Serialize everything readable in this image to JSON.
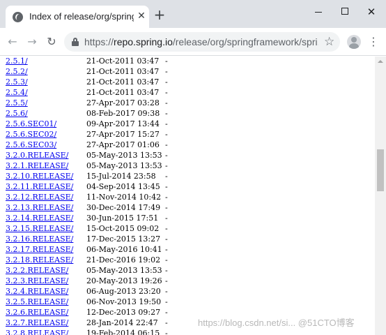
{
  "browser": {
    "tab_title": "Index of release/org/springframework",
    "url_scheme": "https://",
    "url_host": "repo.spring.io",
    "url_path": "/release/org/springframework/spri..."
  },
  "listing": {
    "rows": [
      {
        "name": "2.5.1/",
        "date": "21-Oct-2011 03:47",
        "size": "-"
      },
      {
        "name": "2.5.2/",
        "date": "21-Oct-2011 03:47",
        "size": "-"
      },
      {
        "name": "2.5.3/",
        "date": "21-Oct-2011 03:47",
        "size": "-"
      },
      {
        "name": "2.5.4/",
        "date": "21-Oct-2011 03:47",
        "size": "-"
      },
      {
        "name": "2.5.5/",
        "date": "27-Apr-2017 03:28",
        "size": "-"
      },
      {
        "name": "2.5.6/",
        "date": "08-Feb-2017 09:38",
        "size": "-"
      },
      {
        "name": "2.5.6.SEC01/",
        "date": "09-Apr-2017 13:44",
        "size": "-"
      },
      {
        "name": "2.5.6.SEC02/",
        "date": "27-Apr-2017 15:27",
        "size": "-"
      },
      {
        "name": "2.5.6.SEC03/",
        "date": "27-Apr-2017 01:06",
        "size": "-"
      },
      {
        "name": "3.2.0.RELEASE/",
        "date": "05-May-2013 13:53",
        "size": "-"
      },
      {
        "name": "3.2.1.RELEASE/",
        "date": "05-May-2013 13:53",
        "size": "-"
      },
      {
        "name": "3.2.10.RELEASE/",
        "date": "15-Jul-2014 23:58",
        "size": "-"
      },
      {
        "name": "3.2.11.RELEASE/",
        "date": "04-Sep-2014 13:45",
        "size": "-"
      },
      {
        "name": "3.2.12.RELEASE/",
        "date": "11-Nov-2014 10:42",
        "size": "-"
      },
      {
        "name": "3.2.13.RELEASE/",
        "date": "30-Dec-2014 17:49",
        "size": "-"
      },
      {
        "name": "3.2.14.RELEASE/",
        "date": "30-Jun-2015 17:51",
        "size": "-"
      },
      {
        "name": "3.2.15.RELEASE/",
        "date": "15-Oct-2015 09:02",
        "size": "-"
      },
      {
        "name": "3.2.16.RELEASE/",
        "date": "17-Dec-2015 13:27",
        "size": "-"
      },
      {
        "name": "3.2.17.RELEASE/",
        "date": "06-May-2016 10:41",
        "size": "-"
      },
      {
        "name": "3.2.18.RELEASE/",
        "date": "21-Dec-2016 19:02",
        "size": "-"
      },
      {
        "name": "3.2.2.RELEASE/",
        "date": "05-May-2013 13:53",
        "size": "-"
      },
      {
        "name": "3.2.3.RELEASE/",
        "date": "20-May-2013 19:26",
        "size": "-"
      },
      {
        "name": "3.2.4.RELEASE/",
        "date": "06-Aug-2013 23:20",
        "size": "-"
      },
      {
        "name": "3.2.5.RELEASE/",
        "date": "06-Nov-2013 19:50",
        "size": "-"
      },
      {
        "name": "3.2.6.RELEASE/",
        "date": "12-Dec-2013 09:27",
        "size": "-"
      },
      {
        "name": "3.2.7.RELEASE/",
        "date": "28-Jan-2014 22:47",
        "size": "-"
      },
      {
        "name": "3.2.8.RELEASE/",
        "date": "19-Feb-2014 06:15",
        "size": "-"
      }
    ]
  },
  "watermark": "https://blog.csdn.net/si... @51CTO博客",
  "colors": {
    "link": "#0000ee",
    "tabstrip": "#dee1e6",
    "omnibox": "#f1f3f4"
  }
}
